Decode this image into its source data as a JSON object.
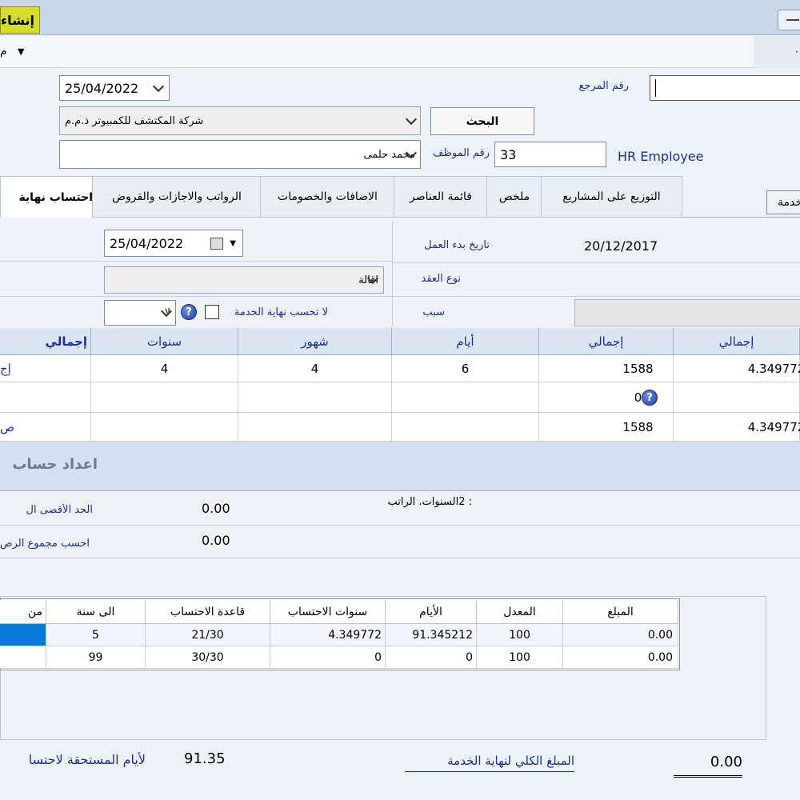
{
  "toolbar": {
    "new_label": "إنشاء"
  },
  "menu": {
    "label": "م"
  },
  "header": {
    "date_value": "25/04/2022",
    "reference_label": "رقم المرجع",
    "company_value": "شركة المكتشف للكمبيوتر ذ.م.م",
    "search_label": "البحث",
    "employee_name": "محمد حلمى",
    "employee_no_label": "رقم الموظف",
    "employee_no_value": "33",
    "hr_label": "HR Employee",
    "side_button_label": "خدمة"
  },
  "tabs": [
    {
      "label": "احتساب نهاية"
    },
    {
      "label": "الرواتب والاجازات والقروض"
    },
    {
      "label": "الاضافات والخصومات"
    },
    {
      "label": "قائمة العناصر"
    },
    {
      "label": "ملخص"
    },
    {
      "label": "التوزيع على المشاريع"
    }
  ],
  "eos": {
    "calc_date": "25/04/2022",
    "start_label": "تاريخ بدء العمل",
    "start_value": "20/12/2017",
    "contract_label": "نوع العقد",
    "reason_value": "اقالة",
    "reason_label": "سبب",
    "no_calc_label": "لا تحسب نهاية الخدمة",
    "no_value": "لا"
  },
  "service_grid": {
    "headers": [
      "إجمالي",
      "سنوات",
      "شهور",
      "أيام",
      "إجمالي",
      "إجمالي"
    ],
    "rows": [
      {
        "label": "إج",
        "years": "4",
        "months": "4",
        "days": "6",
        "total_days": "1588",
        "total_years": "4.349772"
      },
      {
        "label": "",
        "years": "",
        "months": "",
        "days": "",
        "total_days": "0",
        "total_years": ""
      },
      {
        "label": "ص",
        "years": "",
        "months": "",
        "days": "",
        "total_days": "1588",
        "total_years": "4.349772"
      }
    ]
  },
  "settings": {
    "section_title": "اعداد حساب",
    "max_label": "الحد الأقصى ال",
    "max_value": "0.00",
    "salary_note": ": 2السنوات. الراتب",
    "salary_sum_label": "احسب مجموع الرص",
    "salary_sum_value": "0.00"
  },
  "brackets": {
    "headers": [
      "من",
      "الى سنة",
      "قاعدة الاحتساب",
      "سنوات الاحتساب",
      "الأيام",
      "المعدل",
      "المبلغ"
    ],
    "rows": [
      {
        "from": "",
        "to": "5",
        "rule": "21/30",
        "years": "4.349772",
        "days": "91.345212",
        "rate": "100",
        "amount": "0.00"
      },
      {
        "from": "",
        "to": "99",
        "rule": "30/30",
        "years": "0",
        "days": "0",
        "rate": "100",
        "amount": "0.00"
      }
    ]
  },
  "footer": {
    "due_days_label": "لأيام المستحقة لاحتسا",
    "due_days_value": "91.35",
    "total_label": "المبلغ الكلي لنهاية الخدمة",
    "total_value": "0.00"
  }
}
